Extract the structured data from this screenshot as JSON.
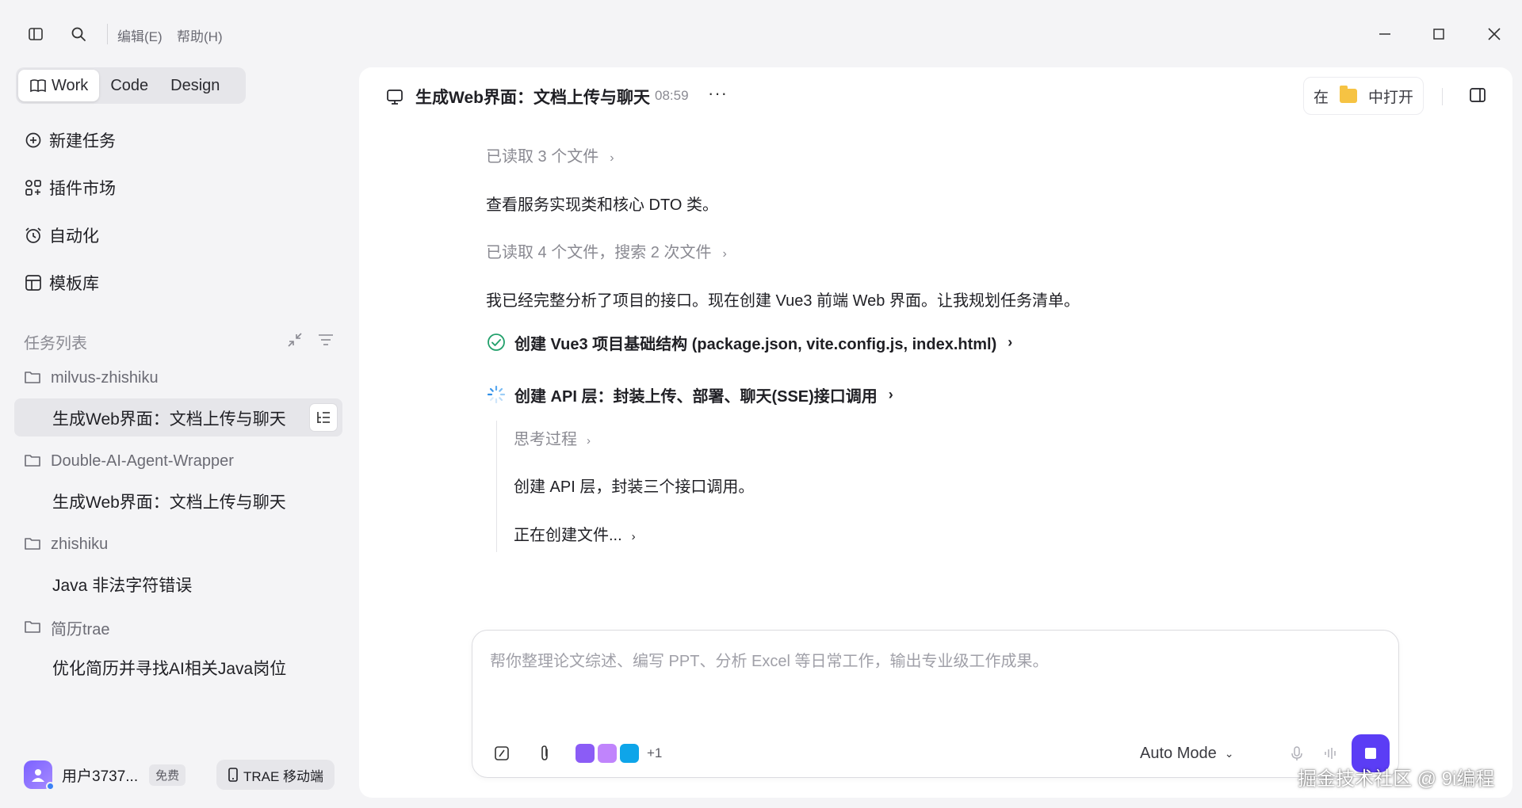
{
  "titlebar": {
    "menu_edit": "编辑(E)",
    "menu_help": "帮助(H)"
  },
  "sidebar": {
    "modes": [
      {
        "label": "Work",
        "active": true
      },
      {
        "label": "Code",
        "active": false
      },
      {
        "label": "Design",
        "active": false
      }
    ],
    "nav": [
      {
        "label": "新建任务",
        "icon": "new-task-icon"
      },
      {
        "label": "插件市场",
        "icon": "plugin-market-icon"
      },
      {
        "label": "自动化",
        "icon": "alarm-clock-icon"
      },
      {
        "label": "模板库",
        "icon": "template-icon"
      }
    ],
    "tasks_title": "任务列表",
    "groups": [
      {
        "folder": "milvus-zhishiku",
        "tasks": [
          "生成Web界面：文档上传与聊天"
        ]
      },
      {
        "folder": "Double-AI-Agent-Wrapper",
        "tasks": [
          "生成Web界面：文档上传与聊天"
        ]
      },
      {
        "folder": "zhishiku",
        "tasks": [
          "Java 非法字符错误"
        ]
      },
      {
        "folder": "简历trae",
        "tasks": [
          "优化简历并寻找AI相关Java岗位"
        ]
      }
    ],
    "user": {
      "name": "用户3737...",
      "plan_badge": "免费",
      "mobile_label": "TRAE 移动端"
    }
  },
  "chat": {
    "title": "生成Web界面：文档上传与聊天",
    "time": "08:59",
    "more": "···",
    "open_in_prefix": "在",
    "open_in_suffix": "中打开",
    "messages": {
      "read1": "已读取 3 个文件",
      "text1": "查看服务实现类和核心 DTO 类。",
      "read2": "已读取 4 个文件，搜索 2 次文件",
      "text2": "我已经完整分析了项目的接口。现在创建 Vue3 前端 Web 界面。让我规划任务清单。",
      "step1": "创建 Vue3 项目基础结构 (package.json, vite.config.js, index.html)",
      "step2": "创建 API 层：封装上传、部署、聊天(SSE)接口调用",
      "thinking": "思考过程",
      "sub_text": "创建 API 层，封装三个接口调用。",
      "creating": "正在创建文件..."
    }
  },
  "composer": {
    "placeholder": "帮你整理论文综述、编写 PPT、分析 Excel 等日常工作，输出专业级工作成果。",
    "plugin_more": "+1",
    "mode": "Auto Mode"
  },
  "colors": {
    "accent": "#5b3df5",
    "success": "#22a06b",
    "folder_yellow": "#f6c343"
  },
  "watermark": "掘金技术社区 @ 9i编程"
}
